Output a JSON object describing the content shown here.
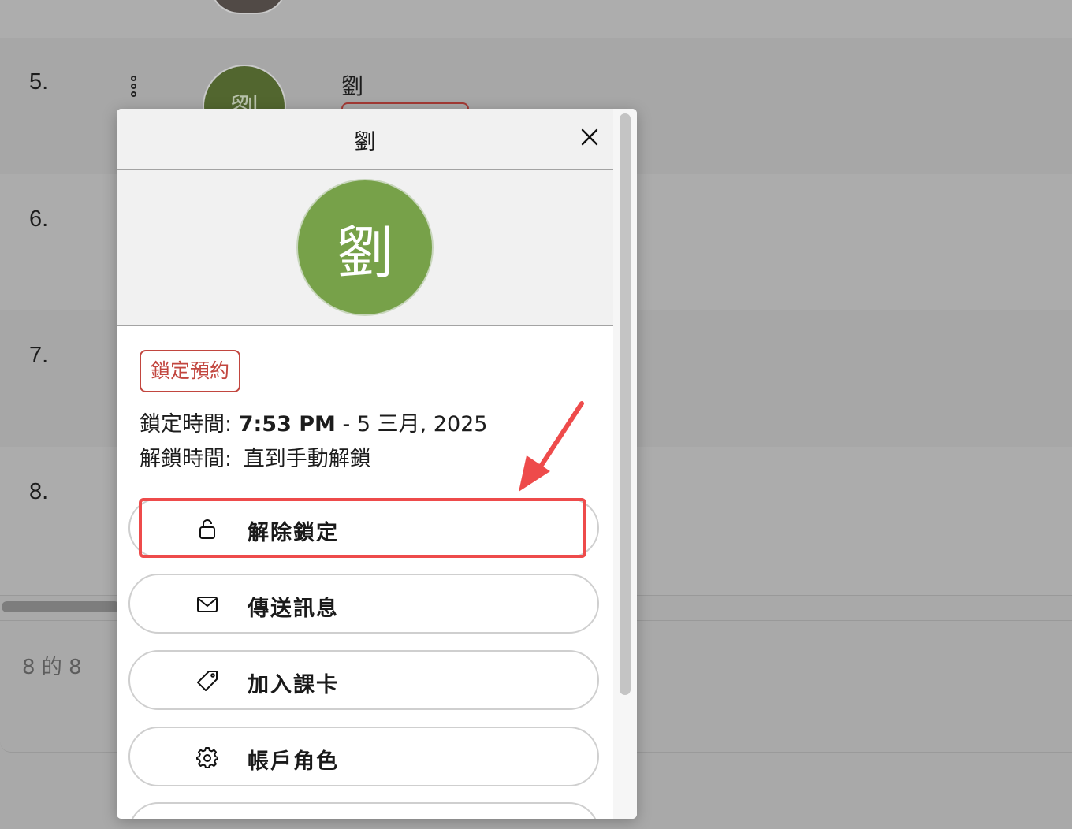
{
  "background": {
    "rows": [
      {
        "number": "5."
      },
      {
        "number": "6."
      },
      {
        "number": "7."
      },
      {
        "number": "8."
      }
    ],
    "row5_avatar_initial": "劉",
    "row5_name": "劉",
    "pager": "8 的 8"
  },
  "modal": {
    "title": "劉",
    "avatar_initial": "劉",
    "avatar_color": "#77a149",
    "status_badge": "鎖定預約",
    "lock_time_label": "鎖定時間:",
    "lock_time_value": "7:53 PM",
    "lock_time_date": "- 5 三月, 2025",
    "unlock_time_label": "解鎖時間:",
    "unlock_time_value": "直到手動解鎖",
    "actions": [
      {
        "label": "解除鎖定",
        "icon": "unlock-icon"
      },
      {
        "label": "傳送訊息",
        "icon": "envelope-icon"
      },
      {
        "label": "加入課卡",
        "icon": "tag-icon"
      },
      {
        "label": "帳戶角色",
        "icon": "gear-icon"
      }
    ]
  },
  "colors": {
    "highlight": "#ee4b4b",
    "badge": "#c2463f"
  }
}
